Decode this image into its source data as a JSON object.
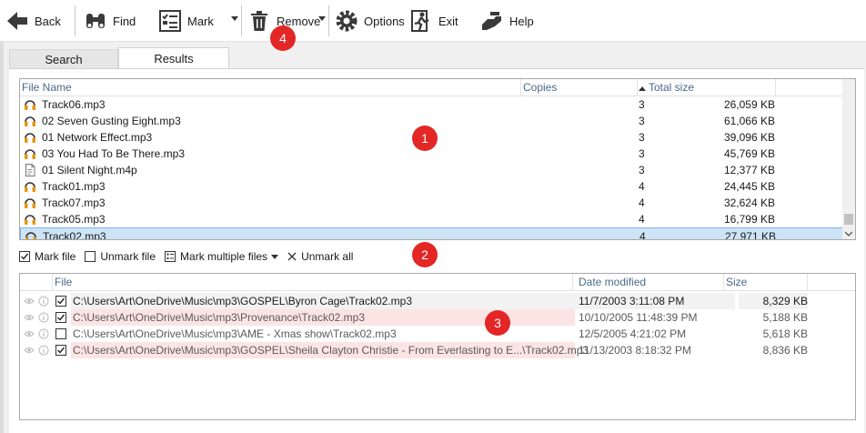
{
  "toolbar": {
    "back": "Back",
    "find": "Find",
    "mark": "Mark",
    "remove": "Remove",
    "options": "Options",
    "exit": "Exit",
    "help": "Help"
  },
  "tabs": [
    "Search",
    "Results"
  ],
  "results": {
    "columns": {
      "file": "File Name",
      "copies": "Copies",
      "size": "Total size"
    },
    "rows": [
      {
        "name": "Track06.mp3",
        "type": "audio",
        "copies": "3",
        "size": "26,059 KB"
      },
      {
        "name": "02 Seven Gusting Eight.mp3",
        "type": "audio",
        "copies": "3",
        "size": "61,066 KB"
      },
      {
        "name": "01 Network Effect.mp3",
        "type": "audio",
        "copies": "3",
        "size": "39,096 KB"
      },
      {
        "name": "03 You Had To Be There.mp3",
        "type": "audio",
        "copies": "3",
        "size": "45,769 KB"
      },
      {
        "name": "01 Silent Night.m4p",
        "type": "document",
        "copies": "3",
        "size": "12,377 KB"
      },
      {
        "name": "Track01.mp3",
        "type": "audio",
        "copies": "4",
        "size": "24,445 KB"
      },
      {
        "name": "Track07.mp3",
        "type": "audio",
        "copies": "4",
        "size": "32,624 KB"
      },
      {
        "name": "Track05.mp3",
        "type": "audio",
        "copies": "4",
        "size": "16,799 KB"
      },
      {
        "name": "Track02.mp3",
        "type": "audio",
        "copies": "4",
        "size": "27,971 KB",
        "selected": true
      }
    ]
  },
  "midbar": {
    "mark_file": "Mark file",
    "unmark_file": "Unmark file",
    "mark_multiple": "Mark multiple files",
    "unmark_all": "Unmark all"
  },
  "duplicates": {
    "columns": {
      "file": "File",
      "date": "Date modified",
      "size": "Size"
    },
    "rows": [
      {
        "path": "C:\\Users\\Art\\OneDrive\\Music\\mp3\\GOSPEL\\Byron Cage\\Track02.mp3",
        "date": "11/7/2003 3:11:08 PM",
        "size": "8,329 KB",
        "checked": true,
        "bg": "#f2f2f2",
        "fg": "#1a1a1a"
      },
      {
        "path": "C:\\Users\\Art\\OneDrive\\Music\\mp3\\Provenance\\Track02.mp3",
        "date": "10/10/2005 11:48:39 PM",
        "size": "5,188 KB",
        "checked": true,
        "bg": "#fde4e4",
        "fg": "#5a5a5a"
      },
      {
        "path": "C:\\Users\\Art\\OneDrive\\Music\\mp3\\AME - Xmas show\\Track02.mp3",
        "date": "12/5/2005 4:21:02 PM",
        "size": "5,618 KB",
        "checked": false,
        "bg": "#ffffff",
        "fg": "#5a5a5a"
      },
      {
        "path": "C:\\Users\\Art\\OneDrive\\Music\\mp3\\GOSPEL\\Sheila Clayton Christie - From Everlasting to E...\\Track02.mp3",
        "date": "11/13/2003 8:18:32 PM",
        "size": "8,836 KB",
        "checked": true,
        "bg": "#fde4e4",
        "fg": "#5a5a5a"
      }
    ]
  },
  "callouts": [
    "1",
    "2",
    "3",
    "4"
  ],
  "colors": {
    "callout": "#e32626",
    "selection": "#cde4f7",
    "marked_row": "#fde4e4",
    "header_text": "#4a6a8a"
  }
}
